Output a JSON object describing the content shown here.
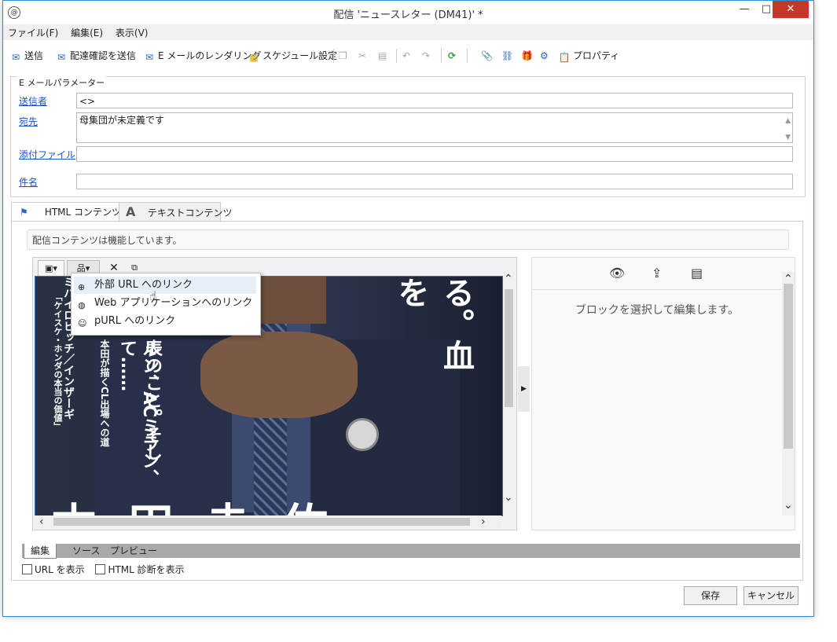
{
  "window": {
    "title": "配信 'ニュースレター (DM41)' *",
    "minimize": "—",
    "maximize": "□",
    "close": "✕"
  },
  "menu": [
    "ファイル(F)",
    "編集(E)",
    "表示(V)"
  ],
  "toolbar": {
    "send": "送信",
    "send_proof": "配達確認を送信",
    "email_render": "E メールのレンダリング",
    "schedule": "スケジュール設定",
    "properties": "プロパティ"
  },
  "email_params": {
    "legend": "E メールパラメーター",
    "sender_label": "送信者",
    "sender_value": "<>",
    "to_label": "宛先",
    "to_value": "母集団が未定義です",
    "attachment_label": "添付ファイル",
    "attachment_value": "",
    "subject_label": "件名",
    "subject_value": ""
  },
  "tabs": {
    "html": "HTML コンテンツ",
    "text": "テキストコンテンツ"
  },
  "content_status": "配信コンテンツは機能しています。",
  "link_menu": {
    "external_url": "外部 URL へのリンク",
    "web_app": "Web アプリケーションへのリンク",
    "purl": "pURL へのリンク"
  },
  "image_text": {
    "line1": "る。血を",
    "line2": "ルン、ACミラン、",
    "line3": "表のこと。そして……",
    "line4": "本田が描くCL出場への道",
    "line5": "ミハイロビッチ／インザーギ",
    "line6": "「ケイスケ・ホンダの本当の価値」",
    "big": "本田圭佑"
  },
  "right_panel": {
    "message": "ブロックを選択して編集します。"
  },
  "mode_tabs": [
    "編集",
    "ソース",
    "プレビュー"
  ],
  "options": {
    "show_url": "URL を表示",
    "html_diag": "HTML 診断を表示"
  },
  "buttons": {
    "save": "保存",
    "cancel": "キャンセル"
  }
}
